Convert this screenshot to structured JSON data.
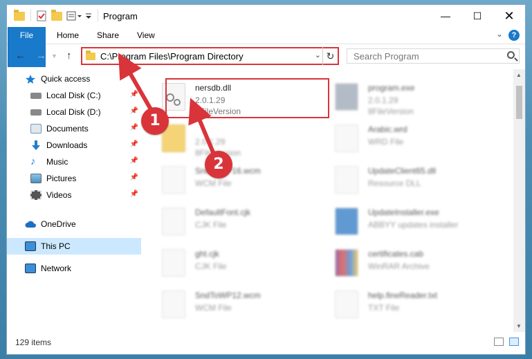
{
  "window": {
    "title": "Program",
    "colors": {
      "accent": "#1979ca",
      "highlight": "#d9343a",
      "selected": "#cce8ff"
    }
  },
  "ribbon": {
    "tabs": [
      "File",
      "Home",
      "Share",
      "View"
    ]
  },
  "address_bar": {
    "path": "C:\\Program Files\\Program Directory"
  },
  "search": {
    "placeholder": "Search Program"
  },
  "sidebar": {
    "items": [
      {
        "label": "Quick access",
        "icon": "star-icon",
        "pinned": false
      },
      {
        "label": "Local Disk (C:)",
        "icon": "drive-icon",
        "pinned": true
      },
      {
        "label": "Local Disk (D:)",
        "icon": "drive-icon",
        "pinned": true
      },
      {
        "label": "Documents",
        "icon": "documents-icon",
        "pinned": true
      },
      {
        "label": "Downloads",
        "icon": "download-icon",
        "pinned": true
      },
      {
        "label": "Music",
        "icon": "music-icon",
        "pinned": true
      },
      {
        "label": "Pictures",
        "icon": "pictures-icon",
        "pinned": true
      },
      {
        "label": "Videos",
        "icon": "videos-icon",
        "pinned": true
      },
      {
        "label": "OneDrive",
        "icon": "cloud-icon",
        "pinned": false
      },
      {
        "label": "This PC",
        "icon": "computer-icon",
        "pinned": false
      },
      {
        "label": "Network",
        "icon": "network-icon",
        "pinned": false
      }
    ]
  },
  "files": [
    {
      "name": "nersdb.dll",
      "line2": "2.0.1.29",
      "line3": "8FileVersion"
    },
    {
      "name": "program.exe",
      "line2": "2.0.1.29",
      "line3": "8FileVersion"
    },
    {
      "name": "",
      "line2": "2.0.1.29",
      "line3": "8FileVersion"
    },
    {
      "name": "Arabic.wrd",
      "line2": "WRD File",
      "line3": ""
    },
    {
      "name": "SndToWP16.wcm",
      "line2": "WCM File",
      "line3": ""
    },
    {
      "name": "UpdateClient65.dll",
      "line2": "Resource DLL",
      "line3": ""
    },
    {
      "name": "DefaultFont.cjk",
      "line2": "CJK File",
      "line3": ""
    },
    {
      "name": "UpdateInstaller.exe",
      "line2": "ABBYY updates installer",
      "line3": ""
    },
    {
      "name": "ght.cjk",
      "line2": "CJK File",
      "line3": ""
    },
    {
      "name": "certificates.cab",
      "line2": "WinRAR Archive",
      "line3": ""
    },
    {
      "name": "SndToWP12.wcm",
      "line2": "WCM File",
      "line3": ""
    },
    {
      "name": "help.fineReader.txt",
      "line2": "TXT File",
      "line3": ""
    }
  ],
  "status": {
    "item_count": "129 items"
  },
  "annotations": {
    "step1": "1",
    "step2": "2"
  }
}
